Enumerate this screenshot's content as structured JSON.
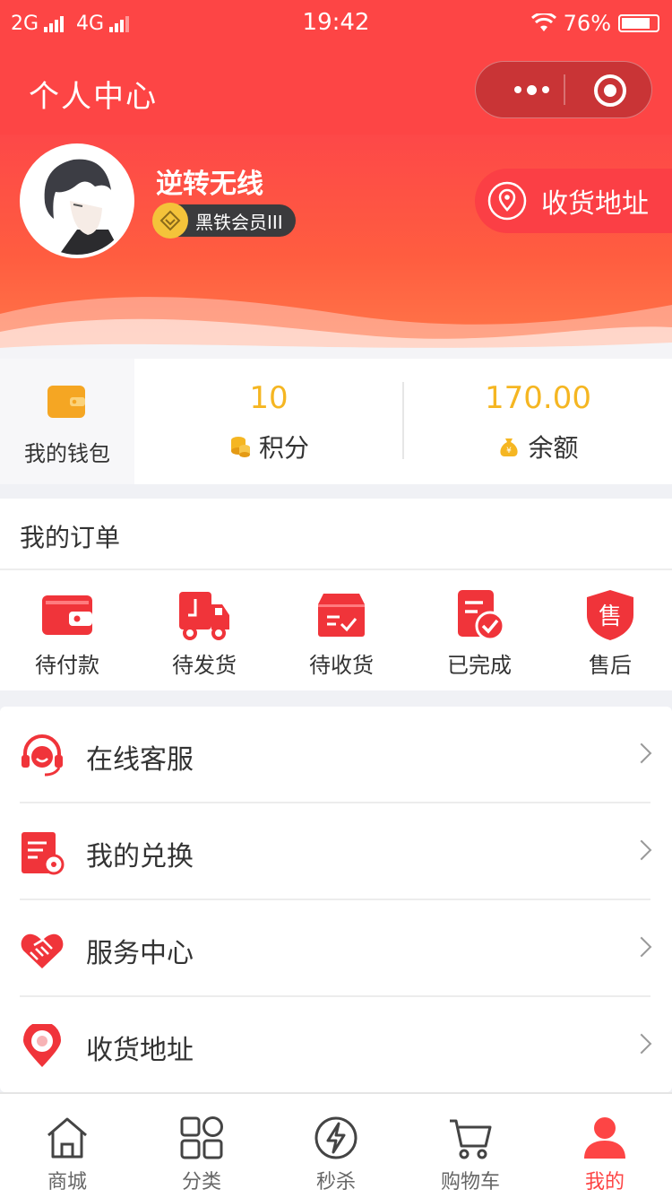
{
  "status_bar": {
    "network1": "2G",
    "network2": "4G",
    "time": "19:42",
    "battery": "76%"
  },
  "title_bar": {
    "title": "个人中心"
  },
  "profile": {
    "username": "逆转无线",
    "level": "黑铁会员III",
    "address_button": "收货地址"
  },
  "wallet": {
    "my_wallet_label": "我的钱包",
    "points_value": "10",
    "points_label": "积分",
    "balance_value": "170.00",
    "balance_label": "余额"
  },
  "orders": {
    "heading": "我的订单",
    "items": [
      {
        "label": "待付款",
        "icon": "wallet-icon"
      },
      {
        "label": "待发货",
        "icon": "truck-icon"
      },
      {
        "label": "待收货",
        "icon": "package-icon"
      },
      {
        "label": "已完成",
        "icon": "completed-icon"
      },
      {
        "label": "售后",
        "icon": "after-sales-icon"
      }
    ]
  },
  "menu": {
    "items": [
      {
        "label": "在线客服",
        "icon": "headset-icon"
      },
      {
        "label": "我的兑换",
        "icon": "exchange-icon"
      },
      {
        "label": "服务中心",
        "icon": "handshake-icon"
      },
      {
        "label": "收货地址",
        "icon": "location-icon"
      }
    ]
  },
  "tabbar": {
    "items": [
      {
        "label": "商城",
        "icon": "home-icon"
      },
      {
        "label": "分类",
        "icon": "category-icon"
      },
      {
        "label": "秒杀",
        "icon": "flash-icon"
      },
      {
        "label": "购物车",
        "icon": "cart-icon"
      },
      {
        "label": "我的",
        "icon": "user-icon"
      }
    ],
    "active": "我的"
  },
  "colors": {
    "primary": "#fd4545",
    "accent_gold": "#f5b622",
    "dark_badge": "#3b3b3d"
  }
}
